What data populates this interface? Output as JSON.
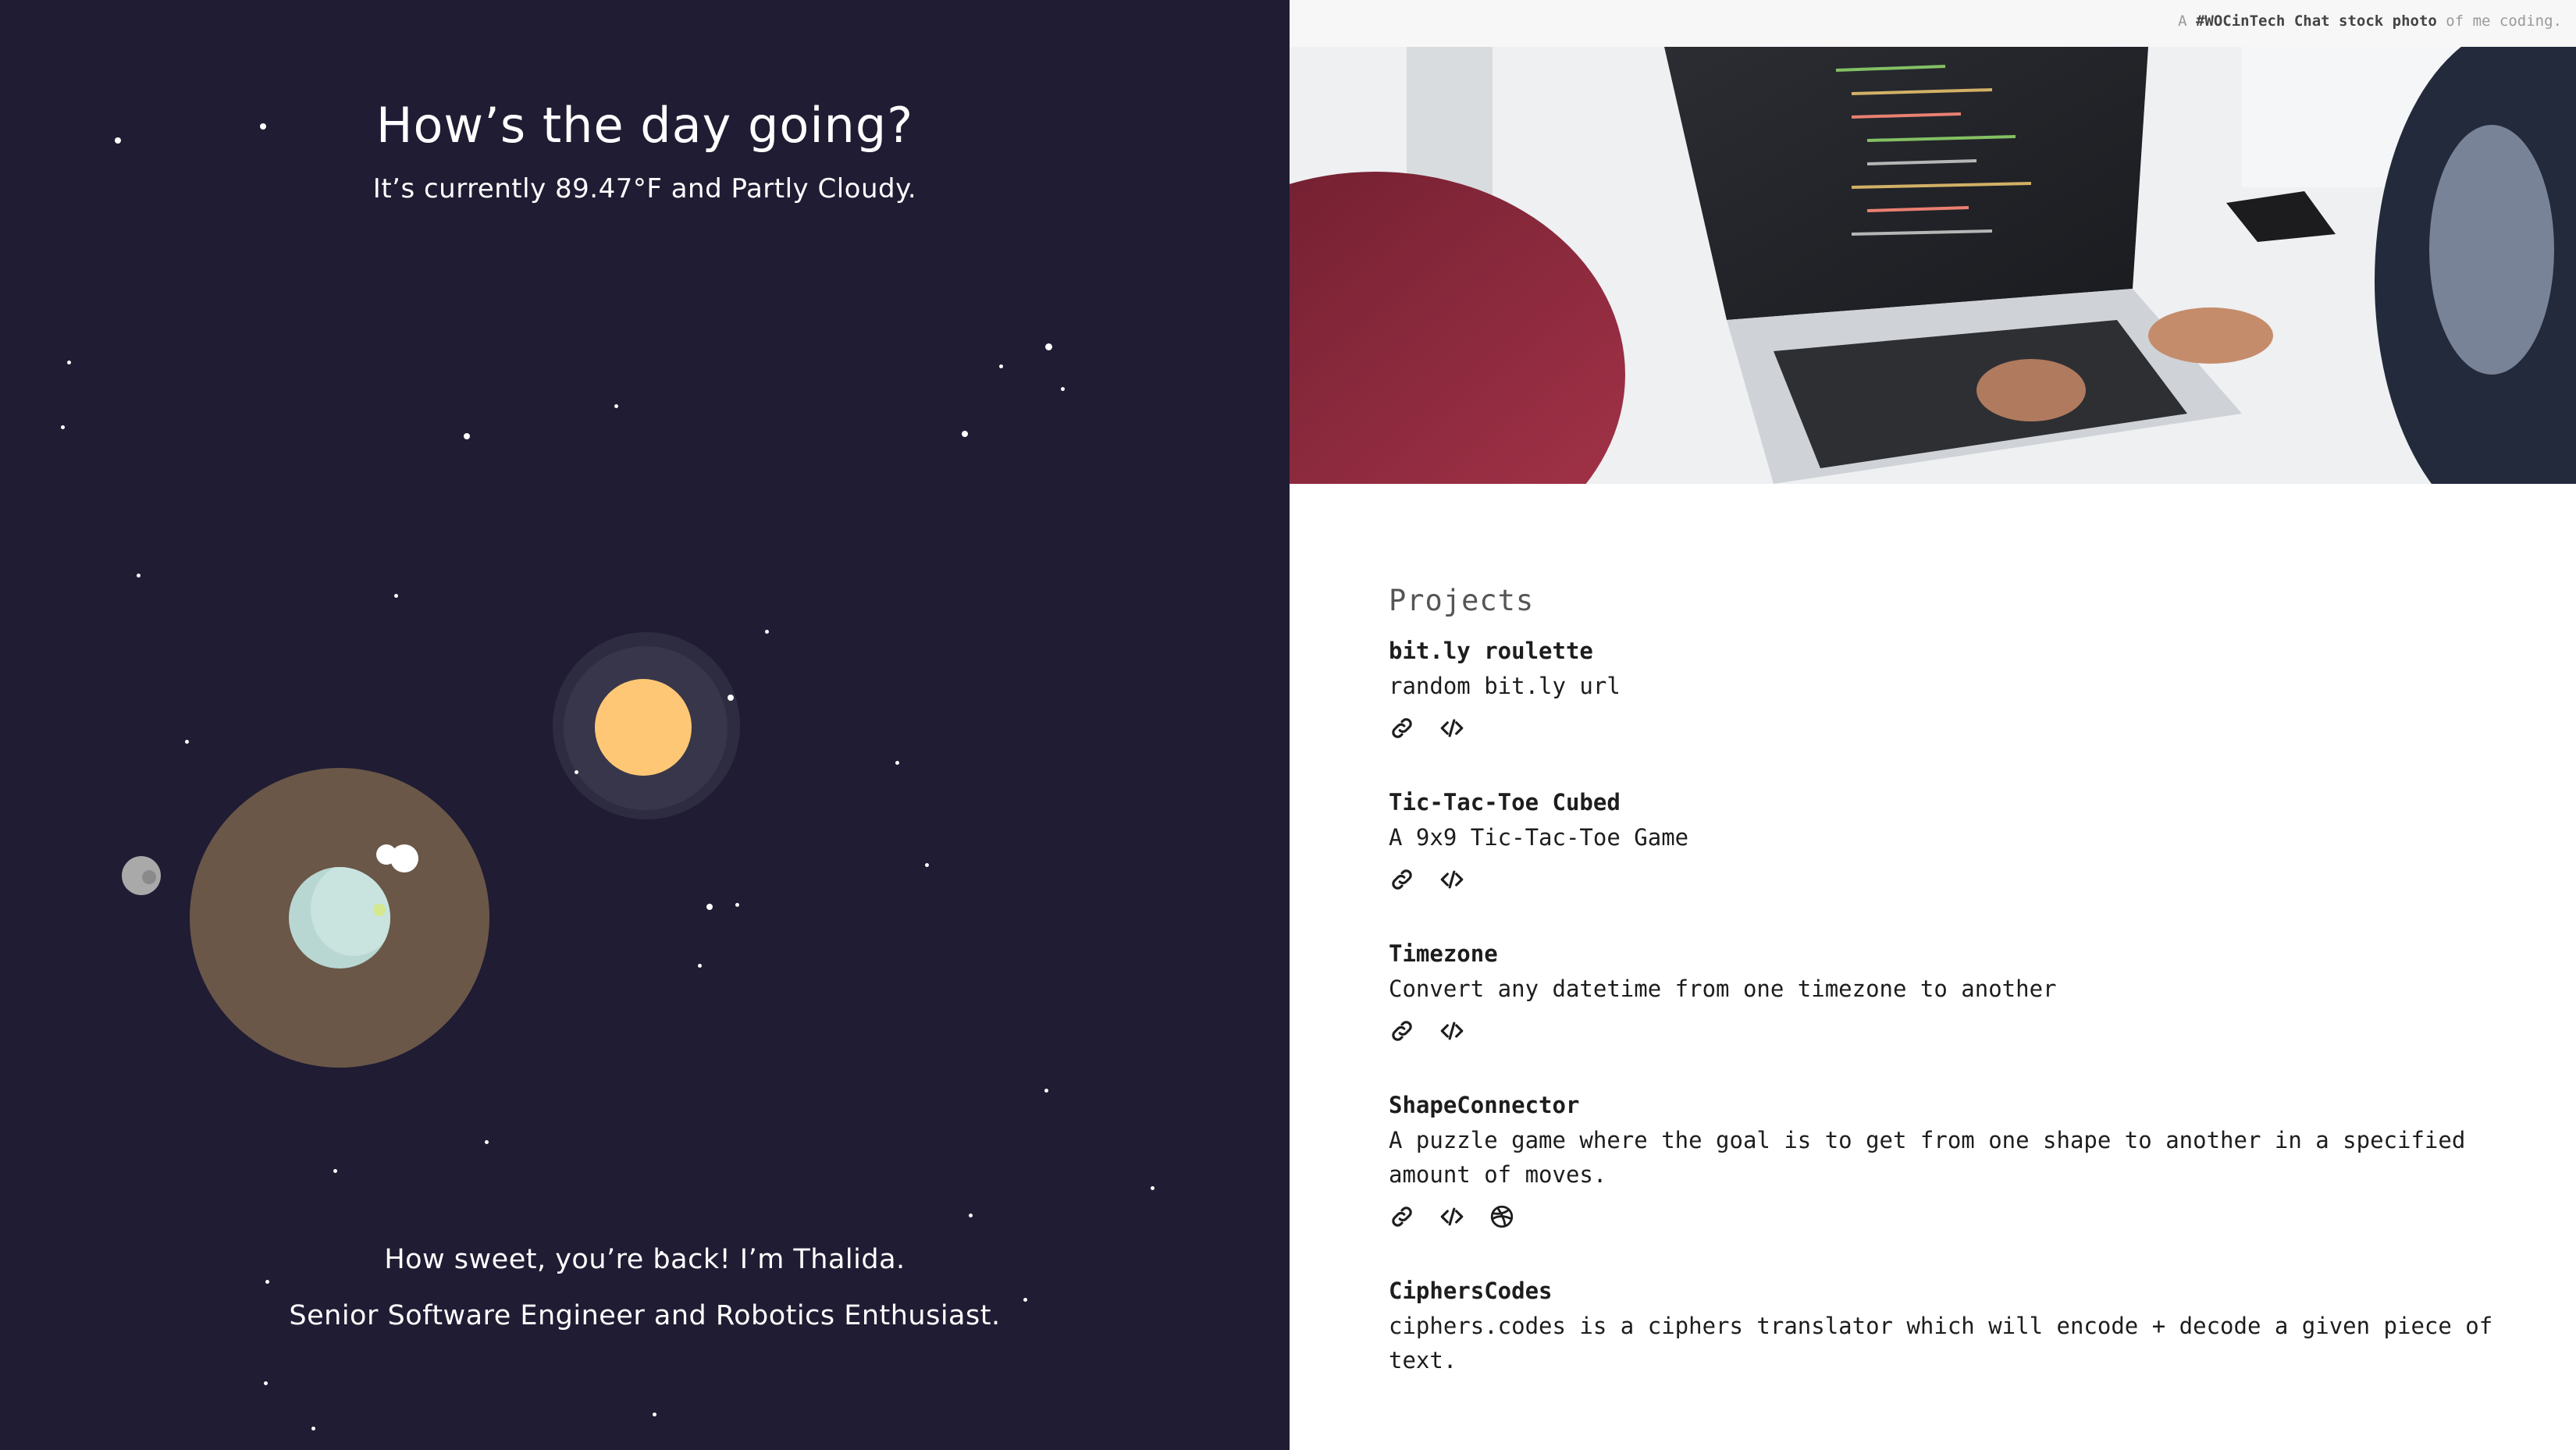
{
  "hero": {
    "greeting": "How’s the day going?",
    "weather": "It’s currently 89.47°F and Partly Cloudy.",
    "intro_line1": "How sweet, you’re back! I’m Thalida.",
    "intro_line2": "Senior Software Engineer and Robotics Enthusiast."
  },
  "photo_caption": {
    "prefix": "A ",
    "link": "#WOCinTech Chat stock photo",
    "suffix": " of me coding."
  },
  "projects": {
    "title": "Projects",
    "items": [
      {
        "name": "bit.ly roulette",
        "desc": "random bit.ly url",
        "icons": [
          "link-icon",
          "code-icon"
        ]
      },
      {
        "name": "Tic-Tac-Toe Cubed",
        "desc": "A 9x9 Tic-Tac-Toe Game",
        "icons": [
          "link-icon",
          "code-icon"
        ]
      },
      {
        "name": "Timezone",
        "desc": "Convert any datetime from one timezone to another",
        "icons": [
          "link-icon",
          "code-icon"
        ]
      },
      {
        "name": "ShapeConnector",
        "desc": "A puzzle game where the goal is to get from one shape to another in a specified amount of moves.",
        "icons": [
          "link-icon",
          "code-icon",
          "dribbble-icon"
        ]
      },
      {
        "name": "CiphersCodes",
        "desc": "ciphers.codes is a ciphers translator which will encode + decode a given piece of text.",
        "icons": []
      }
    ]
  }
}
